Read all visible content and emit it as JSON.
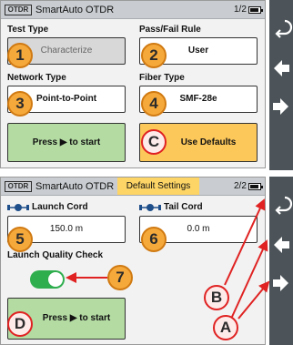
{
  "screen1": {
    "badge": "OTDR",
    "app_title": "SmartAuto OTDR",
    "page": "1/2",
    "test_type_label": "Test Type",
    "test_type_value": "Characterize",
    "pass_fail_label": "Pass/Fail Rule",
    "pass_fail_value": "User",
    "network_type_label": "Network Type",
    "network_type_value": "Point-to-Point",
    "fiber_type_label": "Fiber Type",
    "fiber_type_value": "SMF-28e",
    "start_label": "Press ▶ to start",
    "defaults_label": "Use Defaults"
  },
  "screen2": {
    "badge": "OTDR",
    "app_title": "SmartAuto OTDR",
    "mode_title": "Default Settings",
    "page": "2/2",
    "launch_cord_label": "Launch Cord",
    "launch_cord_value": "150.0 m",
    "tail_cord_label": "Tail Cord",
    "tail_cord_value": "0.0 m",
    "lqc_label": "Launch Quality Check",
    "lqc_state": "on",
    "start_label": "Press ▶ to start"
  },
  "callouts": {
    "c1": "1",
    "c2": "2",
    "c3": "3",
    "c4": "4",
    "c5": "5",
    "c6": "6",
    "c7": "7",
    "cA": "A",
    "cB": "B",
    "cC": "C",
    "cD": "D"
  },
  "colors": {
    "sidebar": "#4c5459",
    "start_button": "#b3dba2",
    "defaults_button": "#fdc85a",
    "callout_number": "#f6a93b",
    "callout_letter_border": "#e02222",
    "toggle_on": "#2fae4e",
    "title_highlight": "#fdd566"
  },
  "icons": {
    "back": "back-arrow-icon",
    "prev": "left-arrow-icon",
    "next": "right-arrow-icon",
    "cord": "fiber-cord-icon"
  }
}
